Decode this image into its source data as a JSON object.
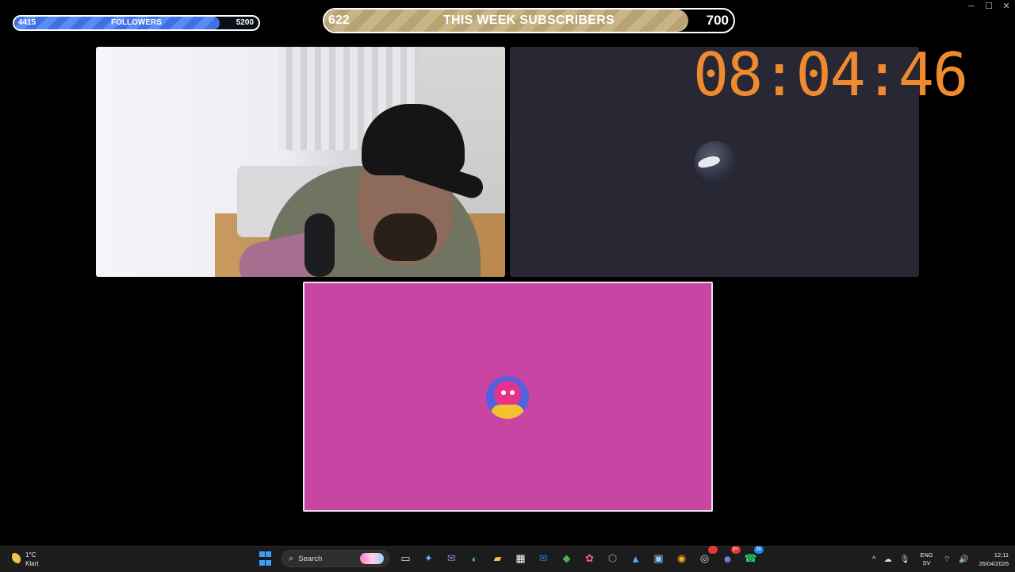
{
  "window_controls": {
    "minimize": "─",
    "maximize": "☐",
    "close": "✕"
  },
  "followers_bar": {
    "min": "4415",
    "label": "FOLLOWERS",
    "max": "5200",
    "progress": 0.84
  },
  "subscribers_bar": {
    "min": "622",
    "label": "THIS WEEK SUBSCRIBERS",
    "max": "700",
    "progress": 0.89
  },
  "countdown": {
    "time": "08:04:46",
    "color": "#f08a2e"
  },
  "panels": {
    "webcam": {
      "icon": "webcam-feed"
    },
    "dark": {
      "background": "#282834",
      "avatar_icon": "user-avatar-dark"
    },
    "pink": {
      "background": "#c945a3",
      "avatar_icon": "user-avatar-pink"
    }
  },
  "taskbar": {
    "weather": {
      "temp": "1°C",
      "condition": "Klart",
      "icon": "moon-icon"
    },
    "search": {
      "label": "Search"
    },
    "apps": [
      {
        "name": "task-view",
        "glyph": "▭",
        "color": "#dddddd"
      },
      {
        "name": "copilot",
        "glyph": "✦",
        "color": "#7aa7ff"
      },
      {
        "name": "teams",
        "glyph": "✉",
        "color": "#7b83eb"
      },
      {
        "name": "edge",
        "glyph": "◐",
        "color": "#2fbfb0"
      },
      {
        "name": "file-explorer",
        "glyph": "▰",
        "color": "#f4c542"
      },
      {
        "name": "store",
        "glyph": "▦",
        "color": "#ffffff"
      },
      {
        "name": "outlook",
        "glyph": "✉",
        "color": "#1f7ad8"
      },
      {
        "name": "vpn",
        "glyph": "◆",
        "color": "#4caf50"
      },
      {
        "name": "m365",
        "glyph": "✿",
        "color": "#e85fa0"
      },
      {
        "name": "app-hex",
        "glyph": "⬡",
        "color": "#9aa0b8"
      },
      {
        "name": "photos",
        "glyph": "▲",
        "color": "#58a6ff"
      },
      {
        "name": "remote-desktop",
        "glyph": "▣",
        "color": "#8fd0ff"
      },
      {
        "name": "chrome",
        "glyph": "◉",
        "color": "#f2b01e"
      },
      {
        "name": "obs",
        "glyph": "◎",
        "color": "#dddddd",
        "badge": "",
        "badge_color": "#e53935"
      },
      {
        "name": "discord",
        "glyph": "☻",
        "color": "#7289da",
        "badge": "9+",
        "badge_color": "#e53935"
      },
      {
        "name": "whatsapp",
        "glyph": "☎",
        "color": "#25d366",
        "badge": "36",
        "badge_color": "#1e88e5"
      }
    ],
    "tray": {
      "chevron": "^",
      "icons": [
        {
          "name": "onedrive",
          "glyph": "☁"
        },
        {
          "name": "microphone",
          "glyph": "🎙"
        }
      ],
      "language_top": "ENG",
      "language_bottom": "SV",
      "wifi": "⌔",
      "volume": "🔊",
      "time": "12:11",
      "date": "26/04/2026"
    }
  }
}
